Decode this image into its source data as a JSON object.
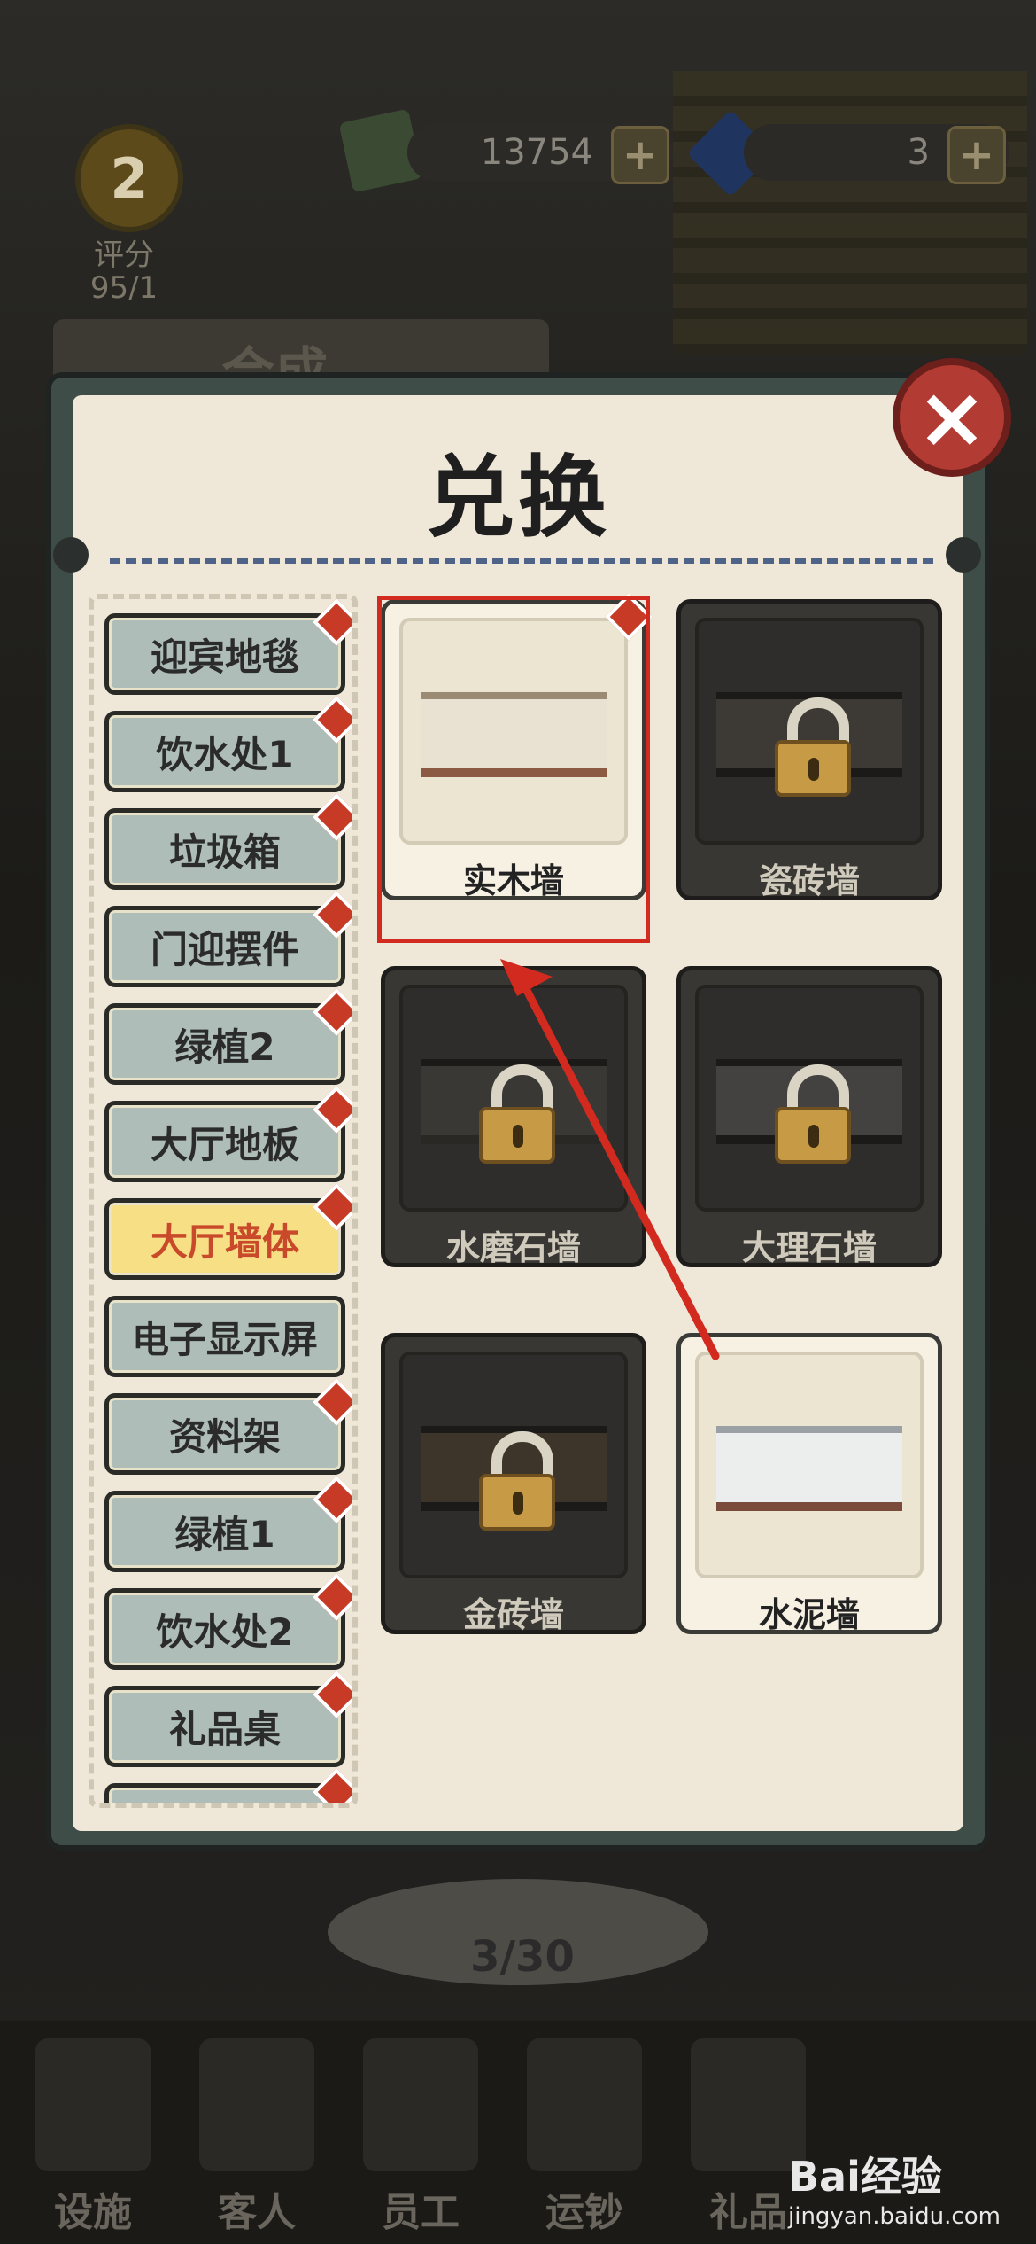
{
  "background": {
    "rank": {
      "level": "2",
      "label": "评分",
      "score": "95/1"
    },
    "cash": "13754",
    "gems": "3",
    "panel_title": "合成",
    "progress": "3/30",
    "bottom_nav": [
      "设施",
      "客人",
      "员工",
      "运钞",
      "礼品"
    ]
  },
  "modal": {
    "title": "兑换",
    "close_label": "×",
    "categories": [
      {
        "label": "迎宾地毯",
        "badge": true
      },
      {
        "label": "饮水处1",
        "badge": true
      },
      {
        "label": "垃圾箱",
        "badge": true
      },
      {
        "label": "门迎摆件",
        "badge": true
      },
      {
        "label": "绿植2",
        "badge": true
      },
      {
        "label": "大厅地板",
        "badge": true
      },
      {
        "label": "大厅墙体",
        "badge": true,
        "active": true
      },
      {
        "label": "电子显示屏",
        "badge": false
      },
      {
        "label": "资料架",
        "badge": true
      },
      {
        "label": "绿植1",
        "badge": true
      },
      {
        "label": "饮水处2",
        "badge": true
      },
      {
        "label": "礼品桌",
        "badge": true
      }
    ],
    "items": [
      {
        "label": "实木墙",
        "locked": false,
        "badge": true,
        "highlighted": true
      },
      {
        "label": "瓷砖墙",
        "locked": true
      },
      {
        "label": "水磨石墙",
        "locked": true
      },
      {
        "label": "大理石墙",
        "locked": true
      },
      {
        "label": "金砖墙",
        "locked": true
      },
      {
        "label": "水泥墙",
        "locked": false
      }
    ]
  },
  "watermark": {
    "brand": "Bai经验",
    "url": "jingyan.baidu.com"
  },
  "colors": {
    "accent_red": "#d22a1e",
    "active_tab": "#f7df86",
    "tab": "#aebdb7"
  }
}
